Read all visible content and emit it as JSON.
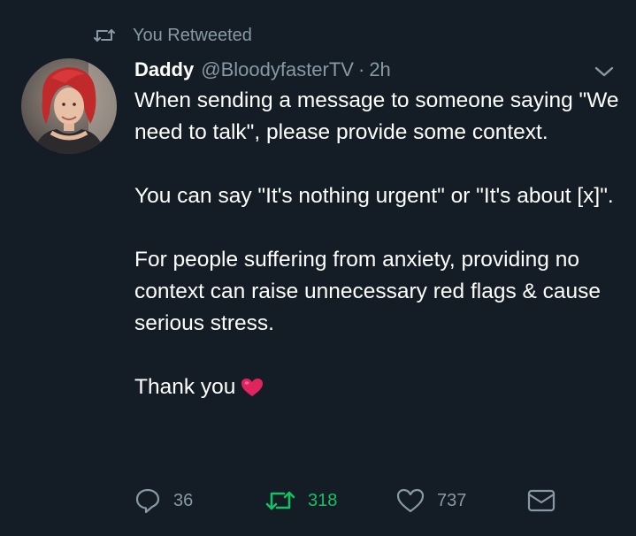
{
  "retweet_context": {
    "label": "You Retweeted",
    "icon": "retweet-icon"
  },
  "tweet": {
    "author_name": "Daddy",
    "author_handle": "@BloodyfasterTV",
    "separator": "·",
    "timestamp": "2h",
    "paragraphs": [
      "When sending a message to someone saying \"We need to talk\", please provide some context.",
      "You can say \"It's nothing urgent\" or \"It's about [x]\".",
      "For people suffering from anxiety, providing no context can raise unnecessary red flags & cause serious stress.",
      "Thank you"
    ],
    "trailing_emoji": "red-heart-emoji"
  },
  "actions": {
    "reply": {
      "icon": "reply-icon",
      "count": "36"
    },
    "retweet": {
      "icon": "retweet-icon",
      "count": "318",
      "active": true
    },
    "like": {
      "icon": "heart-icon",
      "count": "737"
    },
    "dm": {
      "icon": "envelope-icon"
    }
  },
  "colors": {
    "background": "#141d26",
    "text": "#ffffff",
    "muted": "#8899a6",
    "retweet_active": "#17bf63",
    "heart_emoji": "#e0245e"
  }
}
